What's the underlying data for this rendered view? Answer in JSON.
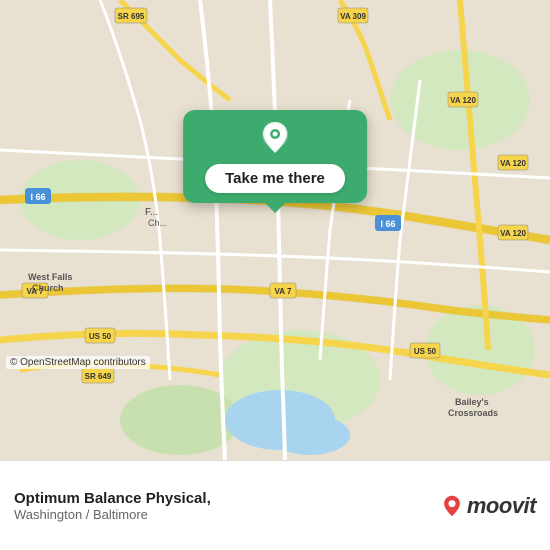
{
  "map": {
    "attribution": "© OpenStreetMap contributors",
    "center_label": "Falls Church area"
  },
  "callout": {
    "button_label": "Take me there"
  },
  "info_bar": {
    "location_name": "Optimum Balance Physical,",
    "location_region": "Washington / Baltimore",
    "moovit_text": "moovit"
  },
  "icons": {
    "pin_icon": "📍",
    "moovit_pin_color": "#e84040"
  }
}
